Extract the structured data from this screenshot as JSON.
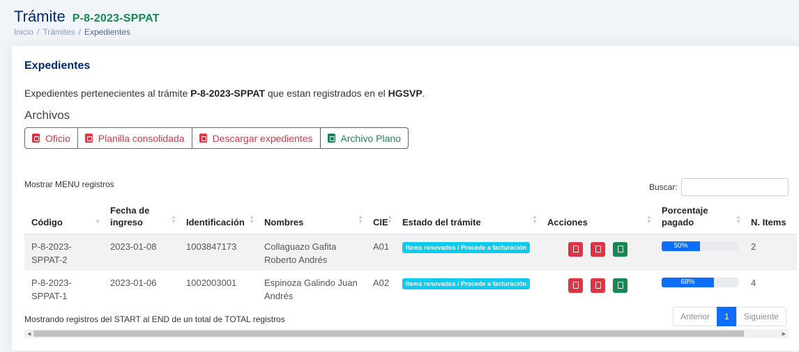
{
  "header": {
    "title": "Trámite",
    "code": "P-8-2023-SPPAT",
    "breadcrumb": [
      "Inicio",
      "Trámites",
      "Expedientes"
    ]
  },
  "card": {
    "title": "Expedientes",
    "desc_prefix": "Expedientes pertenecientes al trámite ",
    "desc_code": "P-8-2023-SPPAT",
    "desc_middle": " que estan registrados en el ",
    "desc_hospital": "HGSVP",
    "desc_suffix": ".",
    "files_title": "Archivos",
    "file_buttons": [
      "Oficio",
      "Planilla consolidada",
      "Descargar expedientes",
      "Archivo Plano"
    ]
  },
  "table_controls": {
    "length_label": "Mostrar MENU registros",
    "search_label": "Buscar:",
    "search_value": ""
  },
  "table": {
    "columns": [
      "Código",
      "Fecha de ingreso",
      "Identificación",
      "Nombres",
      "CIE",
      "Estado del trámite",
      "Acciones",
      "Porcentaje pagado",
      "N. Items"
    ],
    "rows": [
      {
        "codigo": "P-8-2023-SPPAT-2",
        "fecha": "2023-01-08",
        "identificacion": "1003847173",
        "nombres": "Collaguazo Gafita Roberto Andrés",
        "cie": "A01",
        "estado": "Items renovados / Procede a facturación",
        "porcentaje": "50%",
        "porcentaje_value": 50,
        "items": "2"
      },
      {
        "codigo": "P-8-2023-SPPAT-1",
        "fecha": "2023-01-06",
        "identificacion": "1002003001",
        "nombres": "Espinoza Galindo Juan Andrés",
        "cie": "A02",
        "estado": "Items renovados / Procede a facturación",
        "porcentaje": "68%",
        "porcentaje_value": 68,
        "items": "4"
      }
    ]
  },
  "footer": {
    "info": "Mostrando registros del START al END de un total de TOTAL registros",
    "pager_prev": "Anterior",
    "pager_current": "1",
    "pager_next": "Siguiente"
  },
  "colors": {
    "danger": "#dc3545",
    "success": "#198754",
    "info": "#0dcaf0",
    "primary": "#0d6efd",
    "title": "#012970"
  }
}
